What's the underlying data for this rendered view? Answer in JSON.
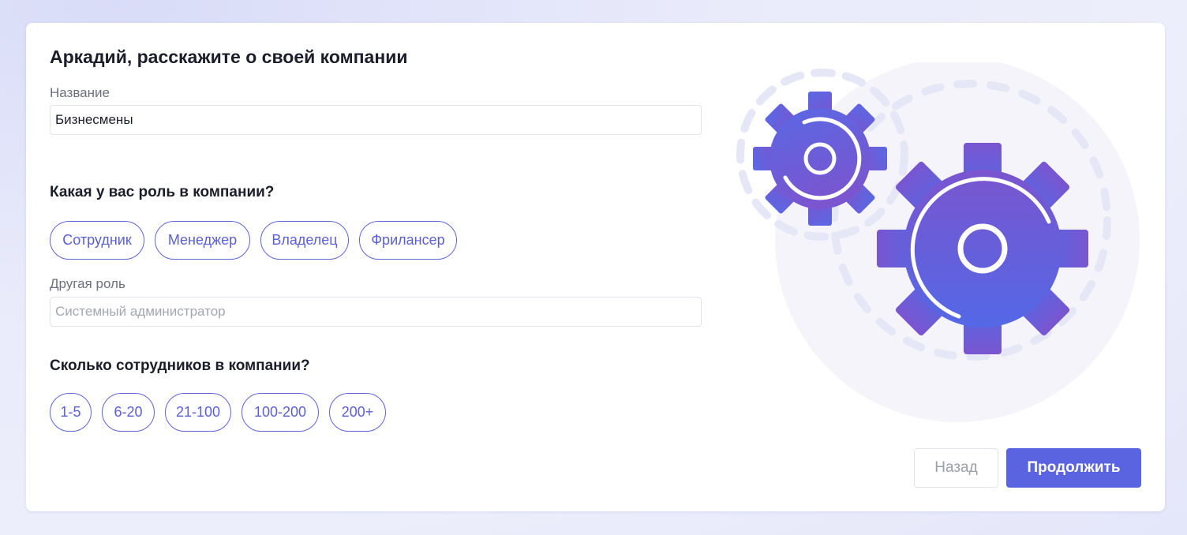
{
  "form": {
    "title": "Аркадий, расскажите о своей компании",
    "name_label": "Название",
    "name_value": "Бизнесмены",
    "role_heading": "Какая у вас роль в компании?",
    "roles": [
      "Сотрудник",
      "Менеджер",
      "Владелец",
      "Фрилансер"
    ],
    "other_role_label": "Другая роль",
    "other_role_placeholder": "Системный администратор",
    "size_heading": "Сколько сотрудников в компании?",
    "sizes": [
      "1-5",
      "6-20",
      "21-100",
      "100-200",
      "200+"
    ]
  },
  "actions": {
    "back_label": "Назад",
    "continue_label": "Продолжить"
  },
  "illustration": {
    "icon": "gears-icon",
    "gear_gradient_start": "#7a55cf",
    "gear_gradient_end": "#5468e6",
    "background_circle": "#f3f3fa",
    "dash_color": "#e8e9f7"
  },
  "colors": {
    "accent": "#5b64e0",
    "chip_border": "#5f64d8",
    "text_primary": "#1c1d2b",
    "text_muted": "#6c6f7d"
  }
}
